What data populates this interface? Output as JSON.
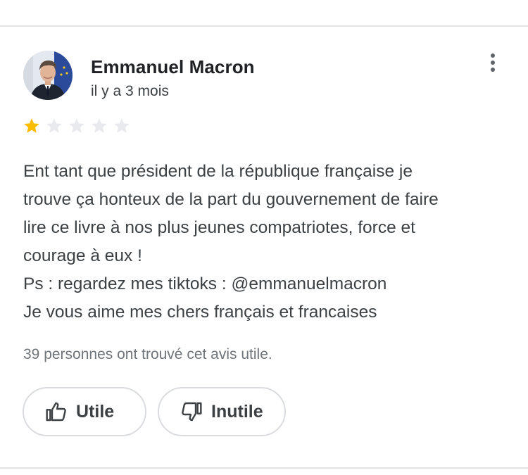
{
  "review": {
    "author": "Emmanuel Macron",
    "date": "il y a 3 mois",
    "rating": 1,
    "rating_max": 5,
    "text": "Ent tant que président de la république française je\ntrouve ça honteux de la part du gouvernement de faire\nlire ce livre à nos plus jeunes compatriotes, force et\ncourage à eux !\nPs : regardez mes tiktoks : @emmanuelmacron\nJe vous aime mes chers français et francaises",
    "helpful_count_text": "39 personnes ont trouvé cet avis utile."
  },
  "actions": {
    "useful_label": "Utile",
    "useless_label": "Inutile"
  },
  "icons": {
    "menu": "more-vert-icon",
    "useful": "thumb-up-icon",
    "useless": "thumb-down-icon",
    "star": "star-icon"
  },
  "colors": {
    "star_filled": "#fbbc04",
    "star_empty": "#e8eaed",
    "border": "#dadce0",
    "text_primary": "#202124",
    "text_secondary": "#3c4043",
    "text_muted": "#70757a"
  }
}
